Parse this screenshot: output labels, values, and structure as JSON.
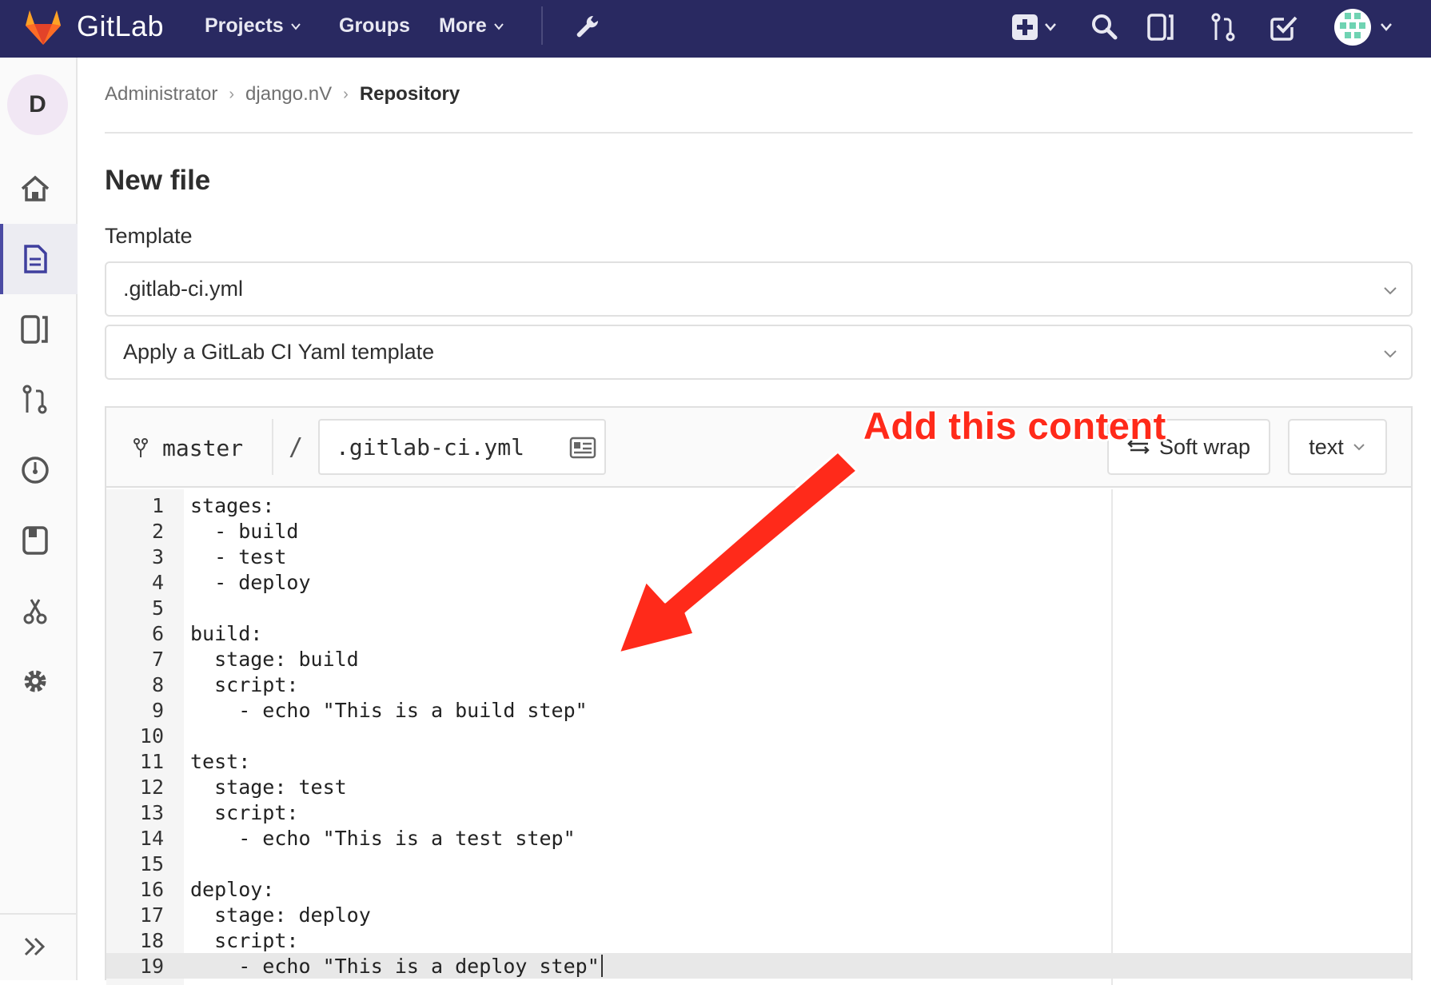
{
  "navbar": {
    "brand": "GitLab",
    "projects": "Projects",
    "groups": "Groups",
    "more": "More"
  },
  "sidebar": {
    "avatar_letter": "D"
  },
  "breadcrumb": [
    "Administrator",
    "django.nV",
    "Repository"
  ],
  "page_title": "New file",
  "template_label": "Template",
  "template_select": ".gitlab-ci.yml",
  "yaml_select": "Apply a GitLab CI Yaml template",
  "editor": {
    "branch": "master",
    "slash": "/",
    "file_name": ".gitlab-ci.yml",
    "soft_wrap": "Soft wrap",
    "mode": "text",
    "lines": [
      "stages:",
      "  - build",
      "  - test",
      "  - deploy",
      "",
      "build:",
      "  stage: build",
      "  script:",
      "    - echo \"This is a build step\"",
      "",
      "test:",
      "  stage: test",
      "  script:",
      "    - echo \"This is a test step\"",
      "",
      "deploy:",
      "  stage: deploy",
      "  script:",
      "    - echo \"This is a deploy step\""
    ]
  },
  "annotation": "Add this content",
  "colors": {
    "navbar": "#292961",
    "annotation": "#ff2a1a",
    "active_accent": "#4b4ba3"
  },
  "icons": [
    "gitlab-logo-icon",
    "chevron-down-icon",
    "wrench-icon",
    "plus-square-icon",
    "search-icon",
    "issues-icon",
    "merge-request-icon",
    "todo-check-icon",
    "user-avatar-icon",
    "home-icon",
    "file-icon",
    "ci-icon",
    "gauge-icon",
    "wiki-icon",
    "snippet-scissors-icon",
    "gear-icon",
    "expand-chevrons-icon",
    "branch-icon",
    "file-card-icon"
  ]
}
